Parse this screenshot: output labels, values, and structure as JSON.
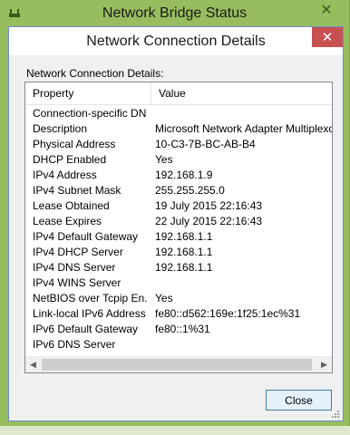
{
  "back_window": {
    "title": "Network Bridge Status",
    "icon": "network-icon",
    "close_icon": "close-icon"
  },
  "dialog": {
    "title": "Network Connection Details",
    "close_icon": "close-icon",
    "caption": "Network Connection Details:",
    "columns": [
      "Property",
      "Value"
    ],
    "rows": [
      {
        "property": "Connection-specific DN...",
        "value": ""
      },
      {
        "property": "Description",
        "value": "Microsoft Network Adapter Multiplexor Driver"
      },
      {
        "property": "Physical Address",
        "value": "10-C3-7B-BC-AB-B4"
      },
      {
        "property": "DHCP Enabled",
        "value": "Yes"
      },
      {
        "property": "IPv4 Address",
        "value": "192.168.1.9"
      },
      {
        "property": "IPv4 Subnet Mask",
        "value": "255.255.255.0"
      },
      {
        "property": "Lease Obtained",
        "value": "19 July 2015 22:16:43"
      },
      {
        "property": "Lease Expires",
        "value": "22 July 2015 22:16:43"
      },
      {
        "property": "IPv4 Default Gateway",
        "value": "192.168.1.1"
      },
      {
        "property": "IPv4 DHCP Server",
        "value": "192.168.1.1"
      },
      {
        "property": "IPv4 DNS Server",
        "value": "192.168.1.1"
      },
      {
        "property": "IPv4 WINS Server",
        "value": ""
      },
      {
        "property": "NetBIOS over Tcpip En...",
        "value": "Yes"
      },
      {
        "property": "Link-local IPv6 Address",
        "value": "fe80::d562:169e:1f25:1ec%31"
      },
      {
        "property": "IPv6 Default Gateway",
        "value": "fe80::1%31"
      },
      {
        "property": "IPv6 DNS Server",
        "value": ""
      }
    ],
    "close_button": "Close"
  },
  "colors": {
    "desktop": "#9bbf63",
    "dialog_border": "#6b8fd0",
    "close_red": "#c75050",
    "button_border": "#3c7fb1"
  }
}
